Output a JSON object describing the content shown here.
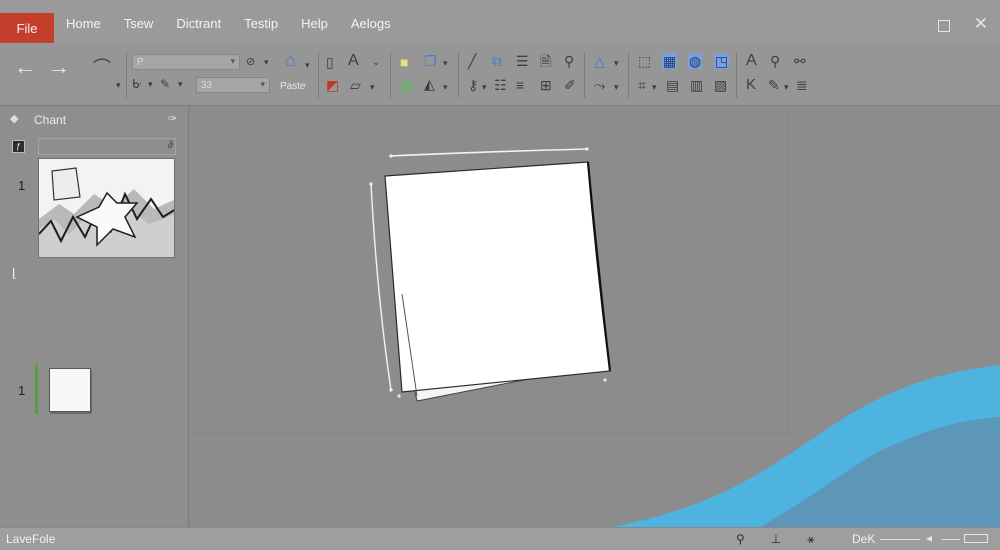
{
  "menu": {
    "file": "File",
    "items": [
      "Home",
      "Tsew",
      "Dictrant",
      "Testip",
      "Help",
      "Aelogs"
    ]
  },
  "ribbon": {
    "font_field": "P",
    "size_field": "33",
    "paste_label": "Paste"
  },
  "panel": {
    "title": "Chant",
    "slides": [
      {
        "number": "1"
      },
      {
        "number": "1"
      }
    ]
  },
  "status": {
    "left_text": "LaveFole",
    "zoom_label": "DeK"
  },
  "colors": {
    "file_tab": "#c43e2c",
    "wave_light": "#4fb3df",
    "wave_dark": "#5c97ba",
    "thumb_marker": "#5b9c3f"
  }
}
